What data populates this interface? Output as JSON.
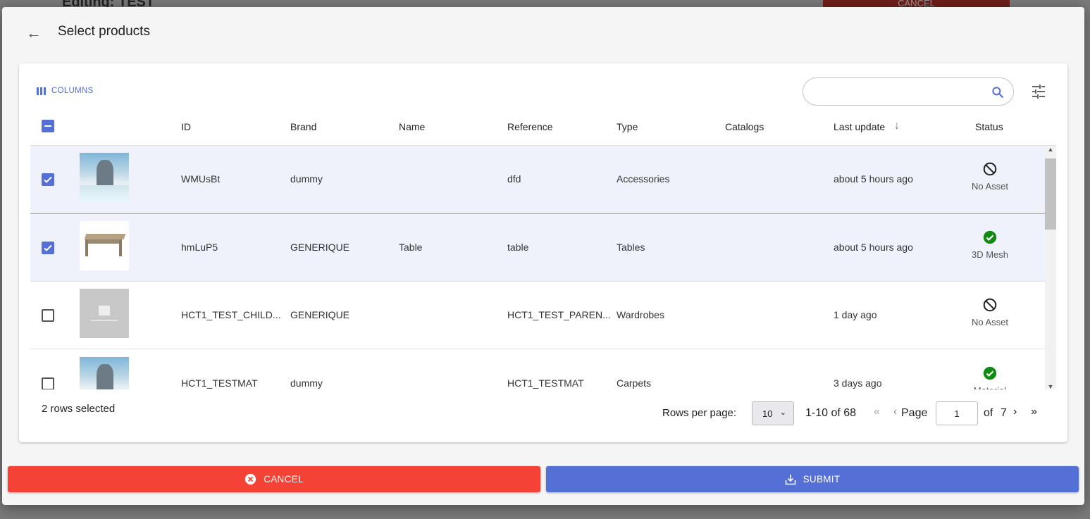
{
  "background": {
    "title": "Editing: TEST",
    "cancel_label": "CANCEL"
  },
  "dialog": {
    "title": "Select products"
  },
  "toolbar": {
    "columns_label": "COLUMNS",
    "search_placeholder": ""
  },
  "table": {
    "headers": {
      "id": "ID",
      "brand": "Brand",
      "name": "Name",
      "reference": "Reference",
      "type": "Type",
      "catalogs": "Catalogs",
      "last_update": "Last update",
      "status": "Status"
    },
    "sort": {
      "column": "Last update",
      "direction": "descending"
    },
    "rows": [
      {
        "selected": true,
        "thumb": "snow-scene",
        "id": "WMUsBt",
        "brand": "dummy",
        "name": "",
        "reference": "dfd",
        "type": "Accessories",
        "catalogs": "",
        "last_update": "about 5 hours ago",
        "status": "No Asset",
        "status_icon": "block-icon"
      },
      {
        "selected": true,
        "thumb": "table",
        "id": "hmLuP5",
        "brand": "GENERIQUE",
        "name": "Table",
        "reference": "table",
        "type": "Tables",
        "catalogs": "",
        "last_update": "about 5 hours ago",
        "status": "3D Mesh",
        "status_icon": "check-circle-icon"
      },
      {
        "selected": false,
        "thumb": "placeholder",
        "id": "HCT1_TEST_CHILD...",
        "brand": "GENERIQUE",
        "name": "",
        "reference": "HCT1_TEST_PAREN...",
        "type": "Wardrobes",
        "catalogs": "",
        "last_update": "1 day ago",
        "status": "No Asset",
        "status_icon": "block-icon"
      },
      {
        "selected": false,
        "thumb": "snow-scene",
        "id": "HCT1_TESTMAT",
        "brand": "dummy",
        "name": "",
        "reference": "HCT1_TESTMAT",
        "type": "Carpets",
        "catalogs": "",
        "last_update": "3 days ago",
        "status": "Material",
        "status_icon": "check-circle-icon"
      }
    ]
  },
  "footer": {
    "selected_text": "2 rows selected",
    "rows_per_page_label": "Rows per page:",
    "rows_per_page": "10",
    "range": "1-10 of 68",
    "page_label": "Page",
    "page": "1",
    "of_label": "of",
    "total_pages": "7"
  },
  "actions": {
    "cancel_label": "CANCEL",
    "submit_label": "SUBMIT"
  },
  "colors": {
    "accent": "#5470d6",
    "danger": "#f44336",
    "success": "#118a11"
  }
}
